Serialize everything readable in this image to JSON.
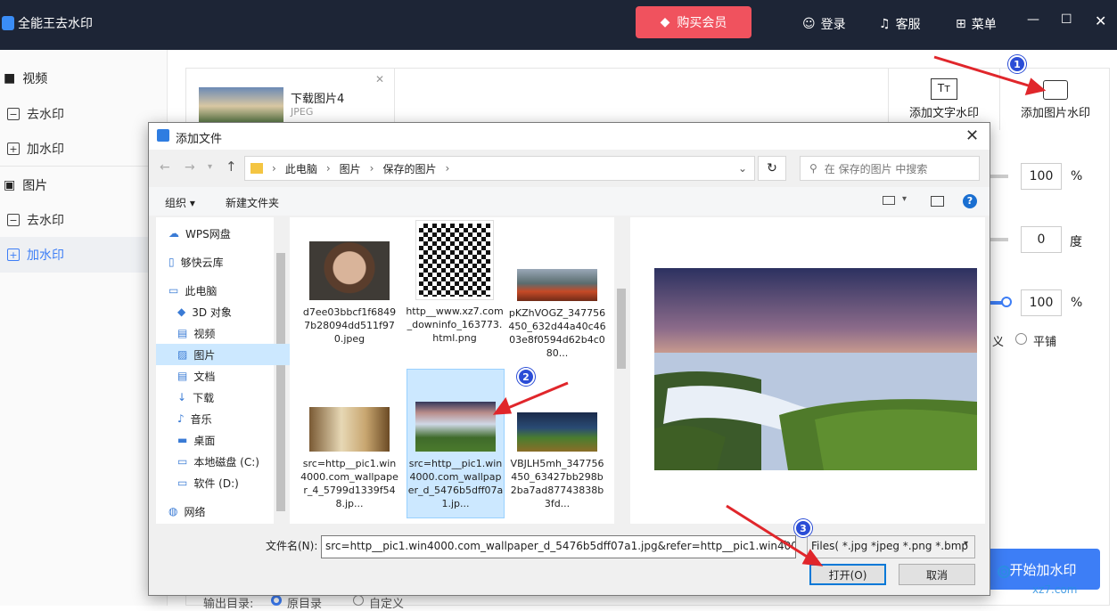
{
  "app": {
    "title": "全能王去水印",
    "buy_label": "购买会员",
    "login": "登录",
    "service": "客服",
    "menu": "菜单",
    "min": "—",
    "max": "☐",
    "close": "✕"
  },
  "sidebar": {
    "video_head": "视频",
    "video_remove": "去水印",
    "video_add": "加水印",
    "image_head": "图片",
    "image_remove": "去水印",
    "image_add": "加水印"
  },
  "main": {
    "file_name": "下载图片4",
    "file_type": "JPEG",
    "add_text_watermark": "添加文字水印",
    "add_image_watermark": "添加图片水印",
    "opacity": "100",
    "opacity_unit": "%",
    "rotation": "0",
    "rotation_unit": "度",
    "scale": "100",
    "scale_unit": "%",
    "custom_partial": "义",
    "tile": "平铺",
    "start_btn": "开始加水印"
  },
  "dialog": {
    "title": "添加文件",
    "breadcrumb": [
      "此电脑",
      "图片",
      "保存的图片"
    ],
    "search_placeholder": "在 保存的图片 中搜索",
    "organize": "组织",
    "new_folder": "新建文件夹",
    "nav": [
      {
        "label": "WPS网盘",
        "icon": "cloud-icon"
      },
      {
        "label": "够快云库",
        "icon": "doc-icon"
      },
      {
        "label": "此电脑",
        "icon": "computer-icon"
      },
      {
        "label": "3D 对象",
        "icon": "cube-icon"
      },
      {
        "label": "视频",
        "icon": "film-icon"
      },
      {
        "label": "图片",
        "icon": "picture-icon"
      },
      {
        "label": "文档",
        "icon": "document-icon"
      },
      {
        "label": "下载",
        "icon": "download-icon"
      },
      {
        "label": "音乐",
        "icon": "music-icon"
      },
      {
        "label": "桌面",
        "icon": "desktop-icon"
      },
      {
        "label": "本地磁盘 (C:)",
        "icon": "disk-icon"
      },
      {
        "label": "软件 (D:)",
        "icon": "disk-icon"
      },
      {
        "label": "网络",
        "icon": "network-icon"
      }
    ],
    "files": [
      {
        "name": "d7ee03bbcf1f68497b28094dd511f970.jpeg"
      },
      {
        "name": "http__www.xz7.com_downinfo_163773.html.png"
      },
      {
        "name": "pKZhVOGZ_347756450_632d44a40c4603e8f0594d62b4c080..."
      },
      {
        "name": "src=http__pic1.win4000.com_wallpaper_4_5799d1339f548.jp..."
      },
      {
        "name": "src=http__pic1.win4000.com_wallpaper_d_5476b5dff07a1.jp..."
      },
      {
        "name": "VBJLH5mh_347756450_63427bb298b2ba7ad87743838b3fd..."
      }
    ],
    "filename_label": "文件名(N):",
    "filename_value": "src=http__pic1.win4000.com_wallpaper_d_5476b5dff07a1.jpg&refer=http__pic1.win4000",
    "filetype": "Files( *.jpg *jpeg *.png *.bmp",
    "open_btn": "打开(O)",
    "cancel_btn": "取消"
  },
  "annotations": [
    "1",
    "2",
    "3"
  ],
  "bottom": {
    "output_label": "输出目录:",
    "original": "原目录",
    "custom": "自定义",
    "watermark": "xz7.com"
  },
  "colors": {
    "titlebar": "#1d2536",
    "buy": "#f0525e",
    "accent": "#3d7ef6",
    "badge": "#2b4dd6",
    "arrow": "#e0262b"
  }
}
